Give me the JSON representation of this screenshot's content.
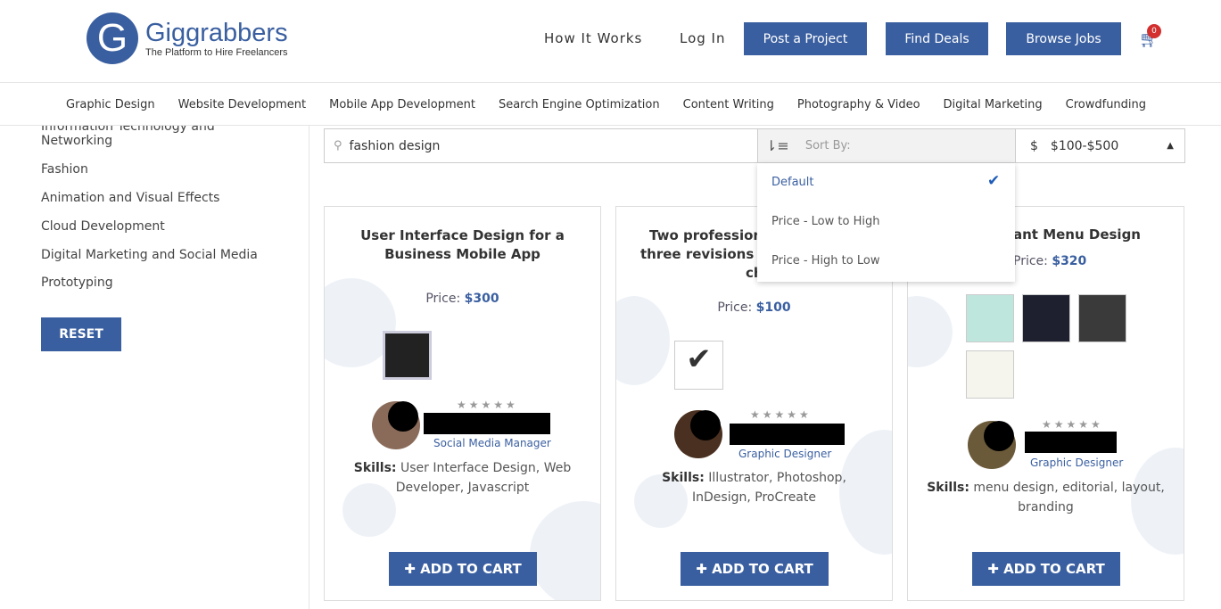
{
  "brand": {
    "name": "Giggrabbers",
    "tagline": "The Platform to Hire Freelancers"
  },
  "nav": {
    "how": "How It Works",
    "login": "Log In",
    "post": "Post a Project",
    "deals": "Find Deals",
    "jobs": "Browse Jobs",
    "cart_count": "0"
  },
  "categories": [
    "Graphic Design",
    "Website Development",
    "Mobile App Development",
    "Search Engine Optimization",
    "Content Writing",
    "Photography & Video",
    "Digital Marketing",
    "Crowdfunding"
  ],
  "sidebar": {
    "items": [
      "Information Technology and",
      "Networking",
      "Fashion",
      "Animation and Visual Effects",
      "Cloud Development",
      "Digital Marketing and Social Media",
      "Prototyping"
    ],
    "reset": "RESET"
  },
  "search": {
    "value": "fashion design"
  },
  "sort": {
    "placeholder": "Sort By:",
    "options": [
      "Default",
      "Price - Low to High",
      "Price - High to Low"
    ],
    "selected": "Default"
  },
  "price_filter": {
    "currency": "$",
    "value": "$100-$500"
  },
  "price_label": "Price:",
  "skills_label": "Skills:",
  "add_to_cart": "ADD TO CART",
  "cards": [
    {
      "title": "User Interface Design for a Business Mobile App",
      "price": "$300",
      "role": "Social Media Manager",
      "skills": "User Interface Design, Web Developer, Javascript"
    },
    {
      "title1": "Two professiona",
      "title2": "three revisions to",
      "title3": "choos",
      "price": "$100",
      "role": "Graphic Designer",
      "skills": "Illustrator, Photoshop, InDesign, ProCreate"
    },
    {
      "title": "ant Menu Design",
      "price": "$320",
      "role": "Graphic Designer",
      "skills": "menu design, editorial, layout, branding"
    }
  ],
  "colors": {
    "accent": "#3a5fa0"
  }
}
